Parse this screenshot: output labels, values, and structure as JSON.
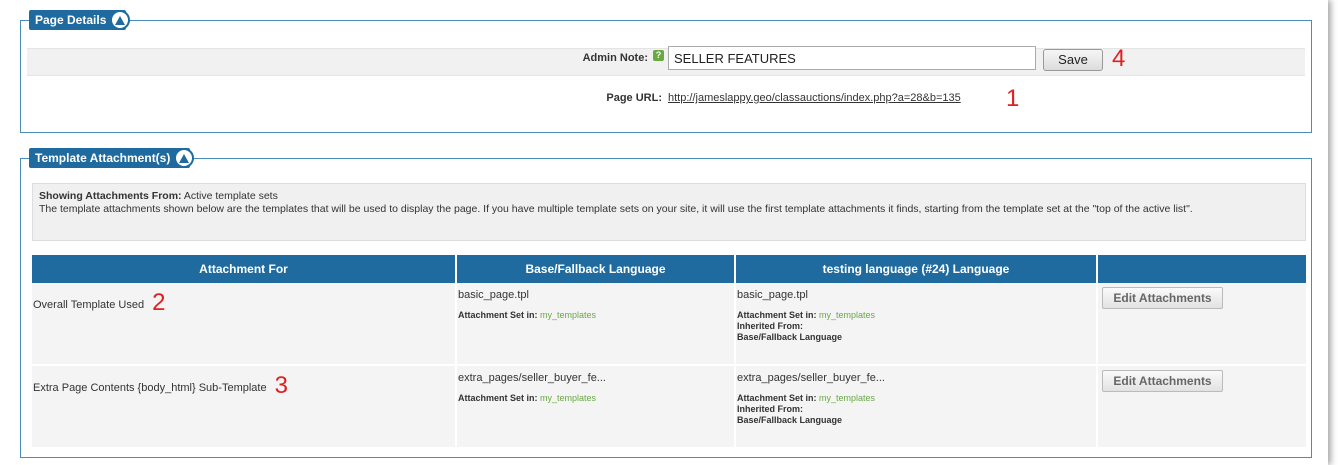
{
  "page_details": {
    "legend": "Page Details",
    "admin_note_label": "Admin Note:",
    "help_icon": "?",
    "admin_note_value": "SELLER FEATURES",
    "save_label": "Save",
    "page_url_label": "Page URL:",
    "page_url": "http://jameslappy.geo/classauctions/index.php?a=28&b=135"
  },
  "annotations": {
    "m1": "1",
    "m2": "2",
    "m3": "3",
    "m4": "4"
  },
  "templates": {
    "legend": "Template Attachment(s)",
    "showing_label": "Showing Attachments From:",
    "showing_value": "Active template sets",
    "description": "The template attachments shown below are the templates that will be used to display the page. If you have multiple template sets on your site, it will use the first template attachments it finds, starting from the template set at the \"top of the active list\".",
    "columns": [
      "Attachment For",
      "Base/Fallback Language",
      "testing language (#24) Language",
      ""
    ],
    "rows": [
      {
        "attachment_for": "Overall Template Used",
        "base_file": "basic_page.tpl",
        "base_set_label": "Attachment Set in:",
        "base_set_value": "my_templates",
        "lang_file": "basic_page.tpl",
        "lang_set_label": "Attachment Set in:",
        "lang_set_value": "my_templates",
        "inherited_label": "Inherited From:",
        "inherited_value": "Base/Fallback Language",
        "edit_label": "Edit Attachments"
      },
      {
        "attachment_for": "Extra Page Contents {body_html} Sub-Template",
        "base_file": "extra_pages/seller_buyer_fe...",
        "base_set_label": "Attachment Set in:",
        "base_set_value": "my_templates",
        "lang_file": "extra_pages/seller_buyer_fe...",
        "lang_set_label": "Attachment Set in:",
        "lang_set_value": "my_templates",
        "inherited_label": "Inherited From:",
        "inherited_value": "Base/Fallback Language",
        "edit_label": "Edit Attachments"
      }
    ]
  },
  "colors": {
    "header_blue": "#1f6b9f",
    "border_blue": "#4a8db8",
    "marker_red": "#e02020",
    "link_green": "#6aa843"
  },
  "icons": {
    "toggle": "collapse-up-icon",
    "help": "help-icon"
  }
}
